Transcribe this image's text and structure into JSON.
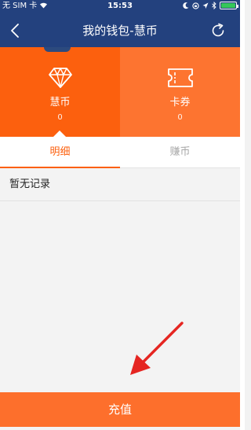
{
  "status_bar": {
    "carrier": "无 SIM 卡",
    "time": "15:53"
  },
  "nav": {
    "title": "我的钱包-慧币",
    "back_icon": "chevron-left-icon",
    "refresh_icon": "refresh-icon"
  },
  "wallet": {
    "coins": {
      "label": "慧币",
      "value": "0",
      "icon": "diamond-icon"
    },
    "coupons": {
      "label": "卡券",
      "value": "0",
      "icon": "ticket-icon"
    }
  },
  "tabs": [
    {
      "label": "明细",
      "active": true
    },
    {
      "label": "赚币",
      "active": false
    }
  ],
  "records": {
    "empty_text": "暂无记录"
  },
  "recharge": {
    "label": "充值"
  },
  "colors": {
    "nav_bg": "#23417e",
    "accent": "#fc600e",
    "header_bg": "#fd6d2a",
    "annotation": "#e52521"
  }
}
